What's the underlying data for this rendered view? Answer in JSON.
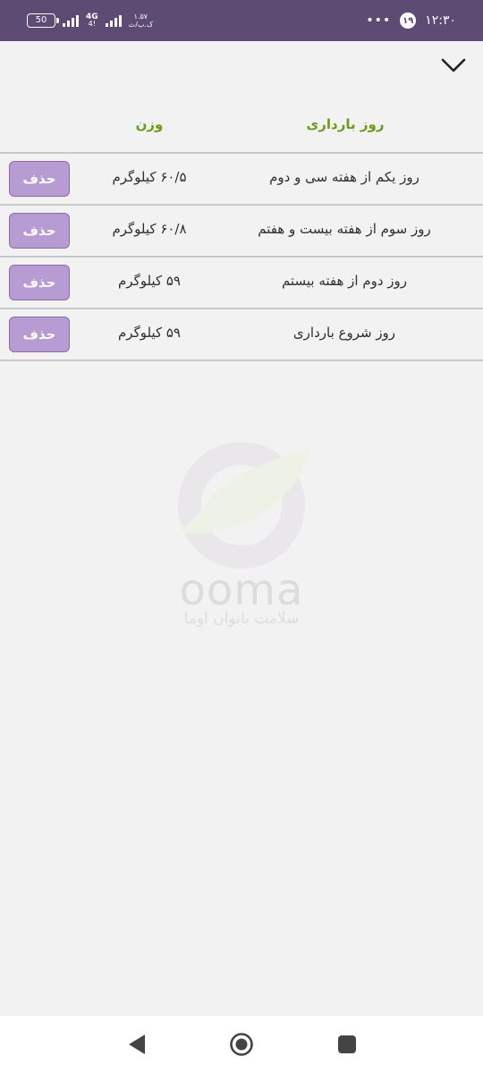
{
  "status_bar": {
    "battery": "50",
    "network_type": "4G",
    "network_sub": "4!",
    "speed_value": "۱.۵۷",
    "speed_unit": "ک.ب/ث",
    "notification_count": "۱۹",
    "more": "•••",
    "time": "۱۲:۳۰"
  },
  "table": {
    "header_day": "روز بارداری",
    "header_weight": "وزن",
    "rows": [
      {
        "day": "روز یکم از هفته سی و دوم",
        "weight": "۶۰/۵ کیلوگرم",
        "delete_label": "حذف"
      },
      {
        "day": "روز سوم از هفته بیست و  هفتم",
        "weight": "۶۰/۸ کیلوگرم",
        "delete_label": "حذف"
      },
      {
        "day": "روز دوم از هفته بیستم",
        "weight": "۵۹ کیلوگرم",
        "delete_label": "حذف"
      },
      {
        "day": "روز شروع بارداری",
        "weight": "۵۹ کیلوگرم",
        "delete_label": "حذف"
      }
    ]
  },
  "watermark": {
    "brand": "ooma",
    "tagline": "سلامت بانوان اوما"
  },
  "icons": {
    "collapse": "chevron-down-icon",
    "back": "back-triangle-icon",
    "home": "home-circle-icon",
    "recent": "recent-square-icon"
  },
  "colors": {
    "status_bar": "#5e4b73",
    "header_text": "#6c9b19",
    "delete_button": "#b79bd3"
  }
}
